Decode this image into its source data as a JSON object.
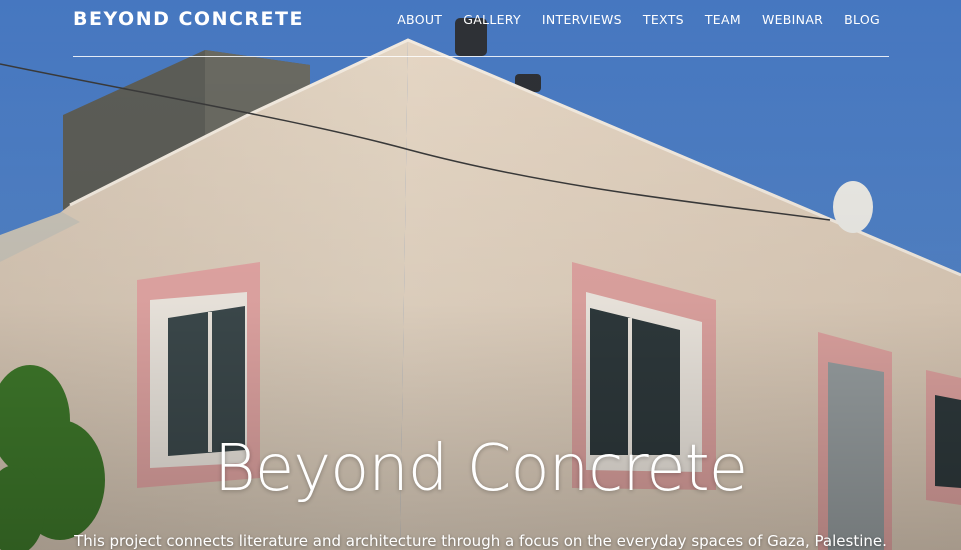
{
  "site": {
    "brand": "BEYOND CONCRETE"
  },
  "nav": {
    "items": [
      {
        "label": "ABOUT"
      },
      {
        "label": "GALLERY"
      },
      {
        "label": "INTERVIEWS"
      },
      {
        "label": "TEXTS"
      },
      {
        "label": "TEAM"
      },
      {
        "label": "WEBINAR"
      },
      {
        "label": "BLOG"
      }
    ]
  },
  "hero": {
    "title": "Beyond Concrete",
    "subtitle": "This project connects literature and architecture through a focus on the everyday spaces of Gaza, Palestine."
  },
  "colors": {
    "sky": "#4e7fbf",
    "wall": "#e7dac8",
    "frame": "#e2a6a3",
    "text": "#ffffff"
  }
}
